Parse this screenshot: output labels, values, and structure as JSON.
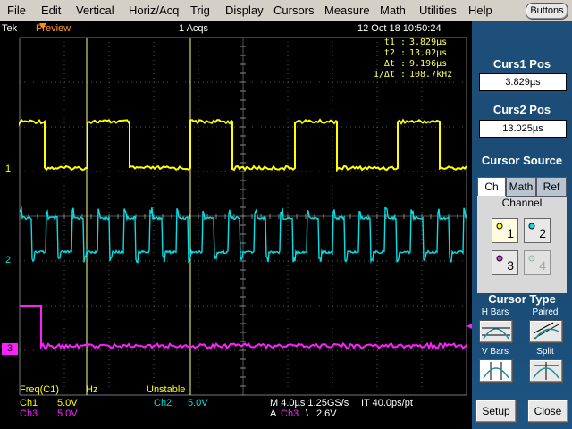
{
  "menu": [
    "File",
    "Edit",
    "Vertical",
    "Horiz/Acq",
    "Trig",
    "Display",
    "Cursors",
    "Measure",
    "Math",
    "Utilities",
    "Help"
  ],
  "buttons_label": "Buttons",
  "header": {
    "brand": "Tek",
    "mode": "Preview",
    "acqs": "1 Acqs",
    "datetime": "12 Oct 18 10:50:24"
  },
  "readout": {
    "t1_label": "t1 :",
    "t1": "3.829µs",
    "t2_label": "t2 :",
    "t2": "13.02µs",
    "dt_label": "Δt :",
    "dt": "9.196µs",
    "inv_label": "1/Δt :",
    "inv": "108.7kHz"
  },
  "channel_markers": {
    "ch1": "1",
    "ch2": "2",
    "ch3": "3"
  },
  "freq_bar": {
    "label": "Freq(C1)",
    "unit": "Hz",
    "status": "Unstable"
  },
  "bottom": {
    "ch1": "Ch1",
    "ch1_scale": "5.0V",
    "ch2": "Ch2",
    "ch2_scale": "5.0V",
    "ch3": "Ch3",
    "ch3_scale": "5.0V",
    "timebase": "M 4.0µs 1.25GS/s",
    "ps": "IT 40.0ps/pt",
    "trig": "A",
    "trig_ch": "Ch3",
    "trig_slope": "\\",
    "trig_level": "2.6V"
  },
  "panel": {
    "curs1_title": "Curs1 Pos",
    "curs1_value": "3.829µs",
    "curs2_title": "Curs2 Pos",
    "curs2_value": "13.025µs",
    "source_title": "Cursor Source",
    "tabs": [
      "Ch",
      "Math",
      "Ref"
    ],
    "channel_label": "Channel",
    "channels": [
      "1",
      "2",
      "3",
      "4"
    ],
    "type_title": "Cursor Type",
    "hbars": "H Bars",
    "paired": "Paired",
    "vbars": "V Bars",
    "split": "Split",
    "setup": "Setup",
    "close": "Close"
  },
  "colors": {
    "ch1": "#ffff00",
    "ch2": "#00e0e8",
    "ch3": "#ff20ff",
    "cursor": "#ffff80"
  }
}
